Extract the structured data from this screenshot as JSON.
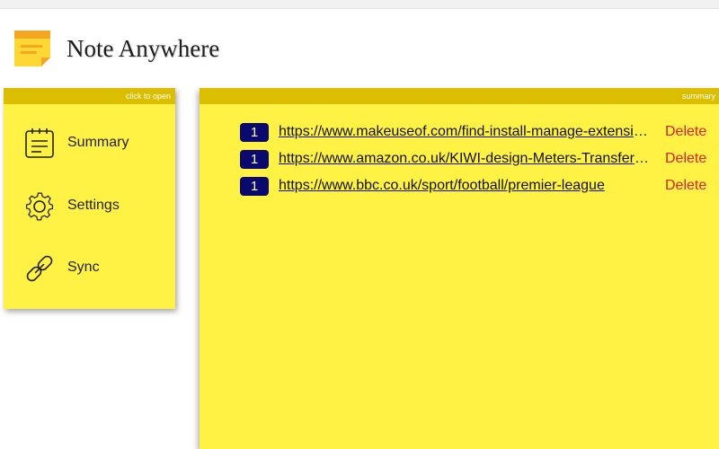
{
  "app": {
    "title": "Note Anywhere",
    "logo_icon": "sticky-note-icon"
  },
  "menu_panel": {
    "bar_label": "click to open",
    "items": [
      {
        "label": "Summary",
        "icon": "notes-calendar-icon"
      },
      {
        "label": "Settings",
        "icon": "gear-icon"
      },
      {
        "label": "Sync",
        "icon": "link-icon"
      }
    ]
  },
  "summary_panel": {
    "bar_label": "summary",
    "links": [
      {
        "count": "1",
        "url": "https://www.makeuseof.com/find-install-manage-extensions-microsoft-edge/",
        "action": "Delete"
      },
      {
        "count": "1",
        "url": "https://www.amazon.co.uk/KIWI-design-Meters-Transfer-Compatible/",
        "action": "Delete"
      },
      {
        "count": "1",
        "url": "https://www.bbc.co.uk/sport/football/premier-league",
        "action": "Delete"
      }
    ]
  },
  "colors": {
    "panel_background": "#fff245",
    "panel_bar": "#dcbe00",
    "badge_background": "#0a0a6e",
    "delete_text": "#d62222"
  }
}
